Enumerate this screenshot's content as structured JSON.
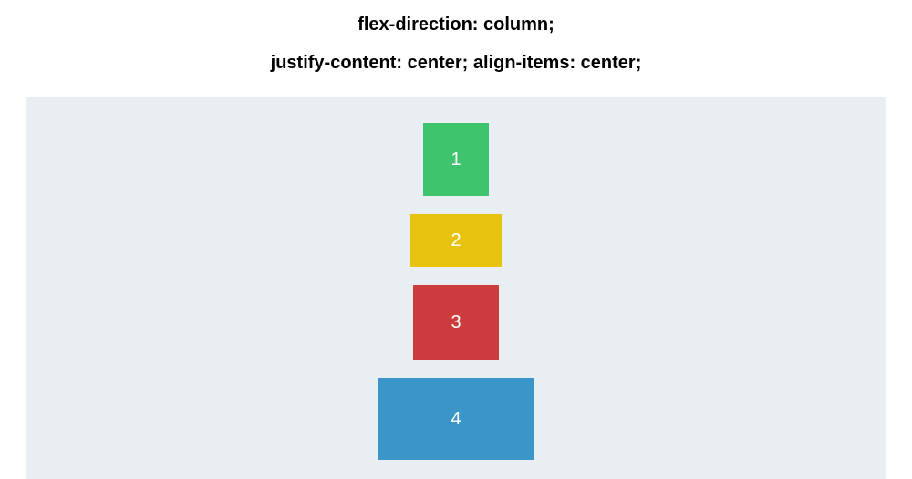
{
  "heading": {
    "line1": "flex-direction: column;",
    "line2": "justify-content: center; align-items: center;"
  },
  "items": [
    {
      "label": "1",
      "color": "#3ec46d"
    },
    {
      "label": "2",
      "color": "#e7c20f"
    },
    {
      "label": "3",
      "color": "#cb3d3d"
    },
    {
      "label": "4",
      "color": "#3a96c9"
    }
  ],
  "flex_properties": {
    "flex-direction": "column",
    "justify-content": "center",
    "align-items": "center"
  }
}
